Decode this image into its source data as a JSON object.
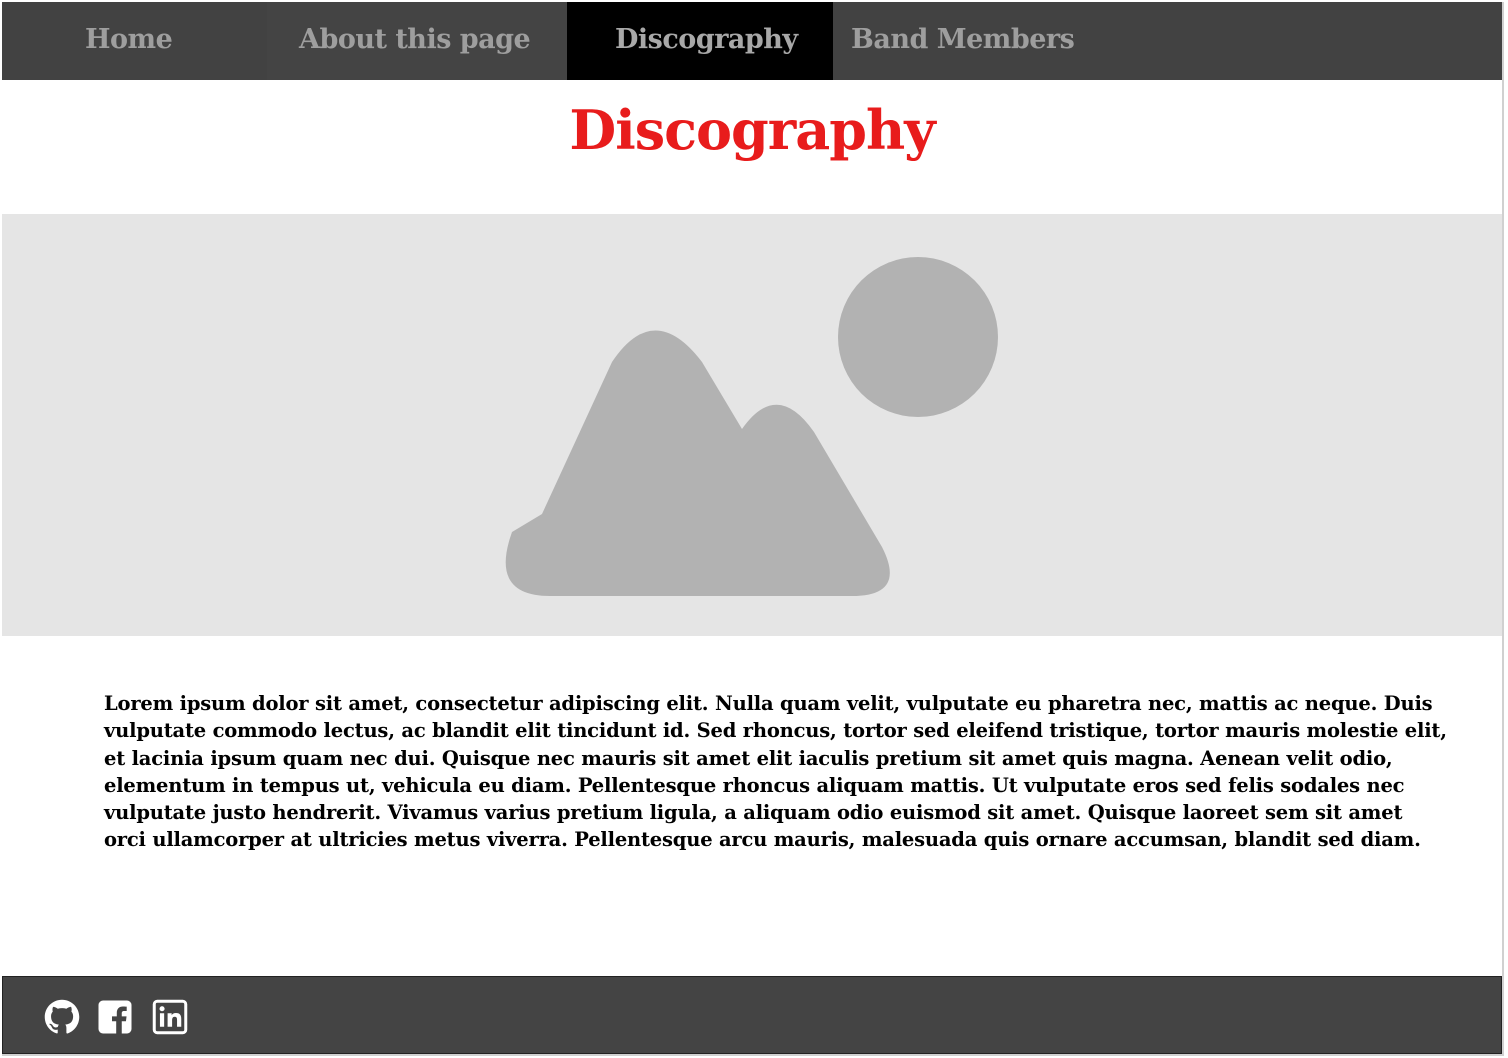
{
  "nav": {
    "items": [
      {
        "label": "Home"
      },
      {
        "label": "About this page"
      },
      {
        "label": "Discography",
        "active": true
      },
      {
        "label": "Band Members"
      }
    ]
  },
  "main": {
    "title": "Discography",
    "hero_image": {
      "icon": "image-placeholder-icon"
    },
    "paragraph": "Lorem ipsum dolor sit amet, consectetur adipiscing elit. Nulla quam velit, vulputate eu pharetra nec, mattis ac neque. Duis vulputate commodo lectus, ac blandit elit tincidunt id. Sed rhoncus, tortor sed eleifend tristique, tortor mauris molestie elit, et lacinia ipsum quam nec dui. Quisque nec mauris sit amet elit iaculis pretium sit amet quis magna. Aenean velit odio, elementum in tempus ut, vehicula eu diam. Pellentesque rhoncus aliquam mattis. Ut vulputate eros sed felis sodales nec vulputate justo hendrerit. Vivamus varius pretium ligula, a aliquam odio euismod sit amet. Quisque laoreet sem sit amet orci ullamcorper at ultricies metus viverra. Pellentesque arcu mauris, malesuada quis ornare accumsan, blandit sed diam."
  },
  "footer": {
    "social": [
      {
        "icon": "github-icon"
      },
      {
        "icon": "facebook-icon"
      },
      {
        "icon": "linkedin-icon"
      }
    ]
  },
  "colors": {
    "nav_bg": "#424242",
    "nav_active_bg": "#000000",
    "nav_text": "#9e9e9e",
    "title": "#e81c1c",
    "hero_bg": "#e5e5e5",
    "placeholder_shape": "#b2b2b2",
    "footer_bg": "#444444"
  }
}
